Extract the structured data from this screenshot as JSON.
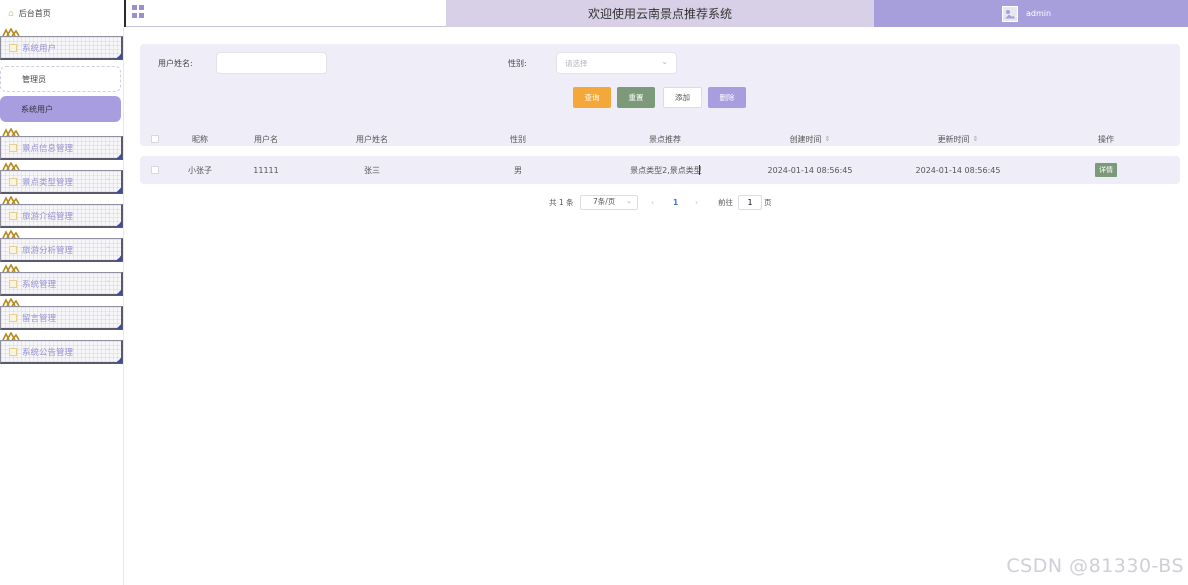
{
  "header": {
    "home_label": "后台首页",
    "home_icon": "home-icon",
    "grid_icon": "grid-menu-icon",
    "title": "欢迎使用云南景点推荐系统",
    "username": "admin",
    "accent_color": "#a79fdc",
    "banner_color": "#d7d0e6"
  },
  "sidebar": {
    "menus": [
      {
        "label": "系统用户",
        "icon": "user-icon",
        "expanded": true,
        "children": [
          {
            "label": "管理员",
            "active": false
          },
          {
            "label": "系统用户",
            "active": true
          }
        ]
      },
      {
        "label": "景点信息管理",
        "icon": "folder-icon"
      },
      {
        "label": "景点类型管理",
        "icon": "folder-icon"
      },
      {
        "label": "旅游介绍管理",
        "icon": "folder-icon"
      },
      {
        "label": "旅游分析管理",
        "icon": "folder-icon"
      },
      {
        "label": "系统管理",
        "icon": "folder-icon"
      },
      {
        "label": "留言管理",
        "icon": "folder-icon"
      },
      {
        "label": "系统公告管理",
        "icon": "folder-icon"
      }
    ]
  },
  "search": {
    "name_label": "用户姓名:",
    "name_value": "",
    "gender_label": "性别:",
    "gender_placeholder": "请选择",
    "buttons": {
      "query": "查询",
      "reset": "重置",
      "add": "添加",
      "delete": "删除"
    }
  },
  "table": {
    "columns": [
      "昵称",
      "用户名",
      "用户姓名",
      "性别",
      "景点推荐",
      "创建时间",
      "更新时间",
      "操作"
    ],
    "sortable_icon": "sort-icon",
    "rows": [
      {
        "nickname": "小张子",
        "username": "11111",
        "real_name": "张三",
        "gender": "男",
        "recommend": "景点类型2,景点类型",
        "created": "2024-01-14 08:56:45",
        "updated": "2024-01-14 08:56:45",
        "action": "详情"
      }
    ]
  },
  "pagination": {
    "total_text": "共 1 条",
    "page_size": "7条/页",
    "current_page": "1",
    "goto_label": "前往",
    "goto_value": "1",
    "page_unit": "页"
  },
  "watermark": "CSDN @81330-BS"
}
